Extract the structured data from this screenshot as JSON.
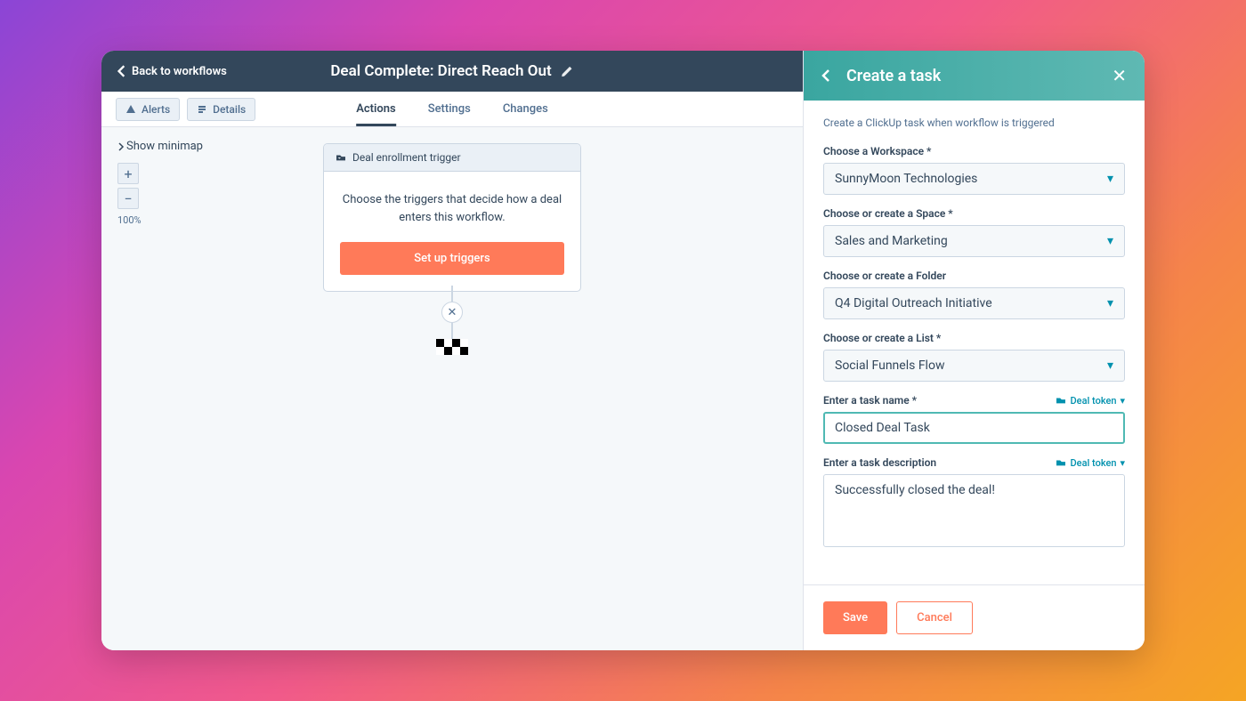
{
  "topbar": {
    "back_label": "Back to workflows",
    "title": "Deal Complete: Direct Reach Out"
  },
  "subbar": {
    "alerts_label": "Alerts",
    "details_label": "Details",
    "tabs": {
      "actions": "Actions",
      "settings": "Settings",
      "changes": "Changes"
    }
  },
  "canvas": {
    "show_minimap": "Show minimap",
    "zoom_level": "100%",
    "trigger_card": {
      "header": "Deal enrollment trigger",
      "body": "Choose the triggers that decide how a deal enters this workflow.",
      "button": "Set up triggers"
    }
  },
  "panel": {
    "title": "Create a task",
    "description": "Create a ClickUp task when workflow is triggered",
    "deal_token_label": "Deal token",
    "fields": {
      "workspace": {
        "label": "Choose a Workspace *",
        "value": "SunnyMoon Technologies"
      },
      "space": {
        "label": "Choose or create a Space *",
        "value": "Sales and Marketing"
      },
      "folder": {
        "label": "Choose or create a Folder",
        "value": "Q4 Digital Outreach Initiative"
      },
      "list": {
        "label": "Choose or create a List *",
        "value": "Social Funnels Flow"
      },
      "task_name": {
        "label": "Enter a task name *",
        "value": "Closed Deal Task"
      },
      "task_desc": {
        "label": "Enter a task description",
        "value": "Successfully closed the deal!"
      }
    },
    "footer": {
      "save": "Save",
      "cancel": "Cancel"
    }
  }
}
